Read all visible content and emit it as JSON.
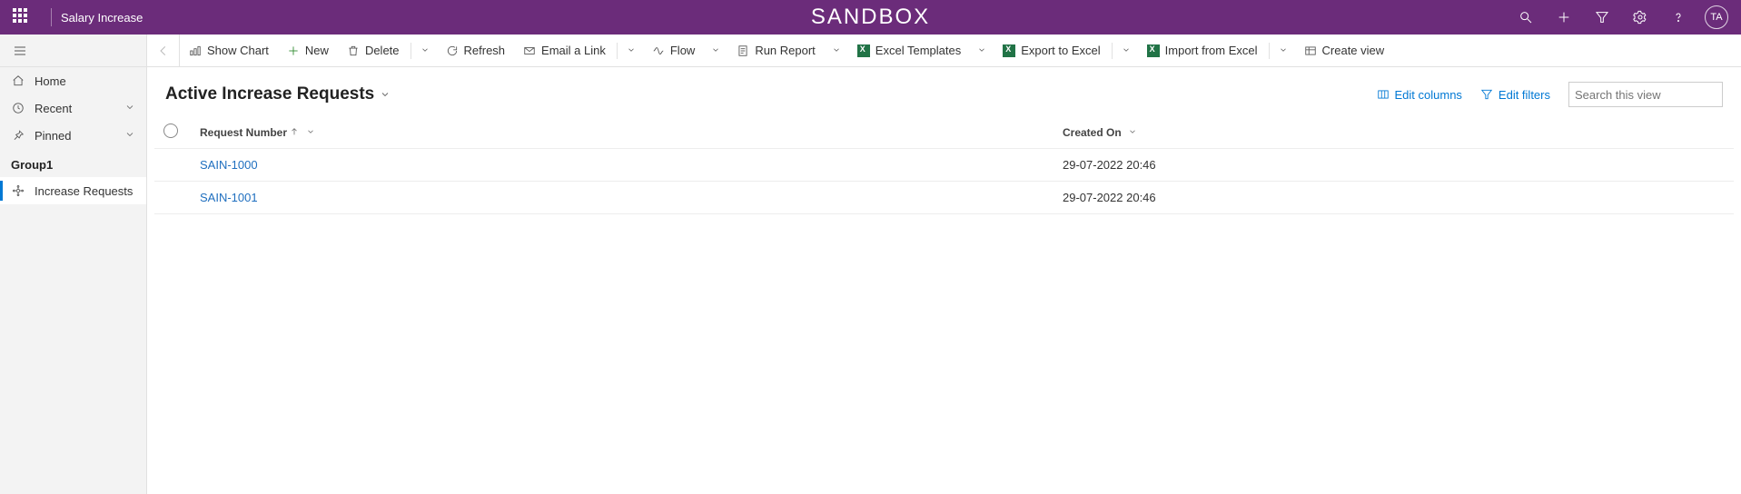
{
  "header": {
    "app_name": "Salary Increase",
    "environment": "SANDBOX",
    "avatar_initials": "TA"
  },
  "sidebar": {
    "home": "Home",
    "recent": "Recent",
    "pinned": "Pinned",
    "group_label": "Group1",
    "increase_requests": "Increase Requests"
  },
  "commandbar": {
    "show_chart": "Show Chart",
    "new": "New",
    "delete": "Delete",
    "refresh": "Refresh",
    "email_link": "Email a Link",
    "flow": "Flow",
    "run_report": "Run Report",
    "excel_templates": "Excel Templates",
    "export_excel": "Export to Excel",
    "import_excel": "Import from Excel",
    "create_view": "Create view"
  },
  "view": {
    "title": "Active Increase Requests",
    "edit_columns": "Edit columns",
    "edit_filters": "Edit filters",
    "search_placeholder": "Search this view"
  },
  "grid": {
    "columns": {
      "request_number": "Request Number",
      "created_on": "Created On"
    },
    "rows": [
      {
        "request_number": "SAIN-1000",
        "created_on": "29-07-2022 20:46"
      },
      {
        "request_number": "SAIN-1001",
        "created_on": "29-07-2022 20:46"
      }
    ]
  }
}
